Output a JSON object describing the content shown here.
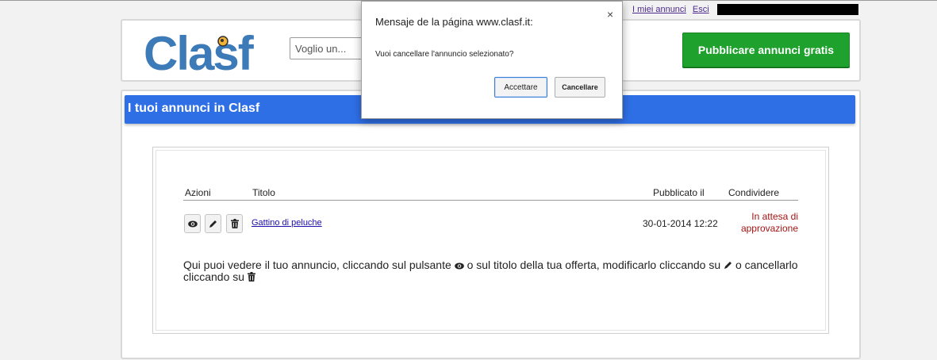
{
  "topbar": {
    "my_ads": "I miei annunci",
    "logout": "Esci"
  },
  "header": {
    "logo": "Clasf",
    "search_placeholder": "Voglio un...",
    "publish_button": "Pubblicare annunci gratis"
  },
  "section": {
    "title": "I tuoi annunci in Clasf"
  },
  "table": {
    "headers": [
      "Azioni",
      "Titolo",
      "Pubblicato il",
      "Condividere"
    ],
    "rows": [
      {
        "title": "Gattino di peluche",
        "date": "30-01-2014 12:22",
        "status": "In attesa di approvazione"
      }
    ]
  },
  "info": {
    "part1": "Qui puoi vedere il tuo annuncio, cliccando sul pulsante",
    "part2": "o sul titolo della tua offerta, modificarlo cliccando su",
    "part3": "o cancellarlo cliccando su"
  },
  "dialog": {
    "title": "Mensaje de la página www.clasf.it:",
    "message": "Vuoi cancellare l'annuncio selezionato?",
    "accept": "Accettare",
    "cancel": "Cancellare",
    "close": "×"
  },
  "colors": {
    "brand_blue": "#2f6fe6",
    "publish_green": "#1fa12e",
    "logo_blue": "#3d7ab8",
    "status_red": "#a31515"
  }
}
